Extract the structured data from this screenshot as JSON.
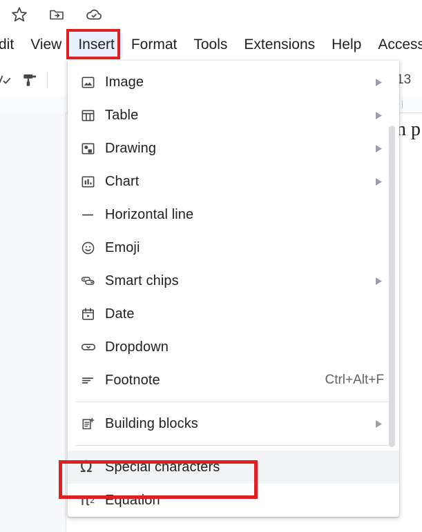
{
  "app": {
    "quick_icons": [
      {
        "name": "star-icon",
        "label": "Star"
      },
      {
        "name": "move-folder-icon",
        "label": "Move to folder"
      },
      {
        "name": "cloud-saved-icon",
        "label": "Saved to Drive"
      }
    ]
  },
  "menubar": {
    "items": [
      {
        "label": "dit",
        "name": "menu-edit",
        "active": false
      },
      {
        "label": "View",
        "name": "menu-view",
        "active": false
      },
      {
        "label": "Insert",
        "name": "menu-insert",
        "active": true
      },
      {
        "label": "Format",
        "name": "menu-format",
        "active": false
      },
      {
        "label": "Tools",
        "name": "menu-tools",
        "active": false
      },
      {
        "label": "Extensions",
        "name": "menu-extensions",
        "active": false
      },
      {
        "label": "Help",
        "name": "menu-help",
        "active": false
      },
      {
        "label": "Access",
        "name": "menu-accessibility",
        "active": false
      }
    ]
  },
  "toolbar": {
    "font_size": "13",
    "icons": [
      {
        "name": "spelling-check-icon"
      },
      {
        "name": "paint-format-icon"
      }
    ]
  },
  "document": {
    "visible_text": "n p"
  },
  "insert_menu": {
    "items": [
      {
        "label": "Image",
        "icon": "image-icon",
        "submenu": true,
        "shortcut": "",
        "highlighted": false
      },
      {
        "label": "Table",
        "icon": "table-icon",
        "submenu": true,
        "shortcut": "",
        "highlighted": false
      },
      {
        "label": "Drawing",
        "icon": "drawing-icon",
        "submenu": true,
        "shortcut": "",
        "highlighted": false
      },
      {
        "label": "Chart",
        "icon": "chart-icon",
        "submenu": true,
        "shortcut": "",
        "highlighted": false
      },
      {
        "label": "Horizontal line",
        "icon": "horizontal-line-icon",
        "submenu": false,
        "shortcut": "",
        "highlighted": false
      },
      {
        "label": "Emoji",
        "icon": "emoji-icon",
        "submenu": false,
        "shortcut": "",
        "highlighted": false
      },
      {
        "label": "Smart chips",
        "icon": "smart-chips-icon",
        "submenu": true,
        "shortcut": "",
        "highlighted": false
      },
      {
        "label": "Date",
        "icon": "date-icon",
        "submenu": false,
        "shortcut": "",
        "highlighted": false
      },
      {
        "label": "Dropdown",
        "icon": "dropdown-icon",
        "submenu": false,
        "shortcut": "",
        "highlighted": false
      },
      {
        "label": "Footnote",
        "icon": "footnote-icon",
        "submenu": false,
        "shortcut": "Ctrl+Alt+F",
        "highlighted": false
      },
      {
        "divider": true
      },
      {
        "label": "Building blocks",
        "icon": "building-blocks-icon",
        "submenu": true,
        "shortcut": "",
        "highlighted": false
      },
      {
        "divider": true
      },
      {
        "label": "Special characters",
        "icon": "omega-icon",
        "submenu": false,
        "shortcut": "",
        "highlighted": true
      },
      {
        "label": "Equation",
        "icon": "pi-squared-icon",
        "submenu": false,
        "shortcut": "",
        "highlighted": false
      }
    ],
    "scrollbar": {
      "name": "menu-scrollbar"
    }
  },
  "annotations": [
    {
      "name": "insert-menu-highlight-box",
      "color": "#e02020",
      "target": "Insert"
    },
    {
      "name": "special-characters-highlight-box",
      "color": "#e02020",
      "target": "Special characters"
    }
  ],
  "colors": {
    "accent": "#e8f0fe",
    "annotation": "#e02020",
    "hover": "#f1f3f4",
    "icon": "#444746",
    "text": "#1f1f1f"
  }
}
